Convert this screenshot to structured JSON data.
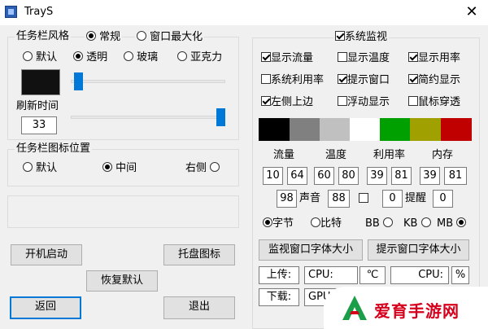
{
  "window": {
    "title": "TrayS",
    "close_glyph": "✕"
  },
  "taskbar_style": {
    "legend": "任务栏风格",
    "mode_options": [
      {
        "label": "常规",
        "selected": true
      },
      {
        "label": "窗口最大化",
        "selected": false
      }
    ],
    "style_options": [
      {
        "label": "默认",
        "selected": false
      },
      {
        "label": "透明",
        "selected": true
      },
      {
        "label": "玻璃",
        "selected": false
      },
      {
        "label": "亚克力",
        "selected": false
      }
    ],
    "color_preview": "#111111",
    "transparency_slider": 0.02,
    "refresh_label": "刷新时间",
    "refresh_value": "33",
    "refresh_slider": 1.0
  },
  "icon_position": {
    "legend": "任务栏图标位置",
    "options": [
      {
        "label": "默认",
        "selected": false
      },
      {
        "label": "中间",
        "selected": true
      },
      {
        "label": "右侧",
        "selected": false
      }
    ]
  },
  "buttons": {
    "autostart": "开机启动",
    "tray_icon": "托盘图标",
    "restore_default": "恢复默认",
    "back": "返回",
    "exit": "退出"
  },
  "monitor": {
    "legend": "系统监视",
    "enabled": true,
    "checks": [
      {
        "label": "显示流量",
        "checked": true
      },
      {
        "label": "显示温度",
        "checked": false
      },
      {
        "label": "显示用率",
        "checked": true
      },
      {
        "label": "系统利用率",
        "checked": false
      },
      {
        "label": "提示窗口",
        "checked": true
      },
      {
        "label": "简约显示",
        "checked": true
      },
      {
        "label": "左侧上边",
        "checked": true
      },
      {
        "label": "浮动显示",
        "checked": false
      },
      {
        "label": "鼠标穿透",
        "checked": false
      }
    ],
    "colors": [
      "#000000",
      "#808080",
      "#c0c0c0",
      "#ffffff",
      "#00a000",
      "#a0a000",
      "#c00000"
    ],
    "headers": {
      "traffic": "流量",
      "temperature": "温度",
      "usage": "利用率",
      "memory": "内存"
    },
    "thresholds": {
      "traffic": [
        "10",
        "64"
      ],
      "temperature": [
        "60",
        "80"
      ],
      "usage": [
        "39",
        "81"
      ],
      "memory": [
        "39",
        "81"
      ]
    },
    "sound_value": "98",
    "sound_label": "声音",
    "sound_field2": "88",
    "reminder_checkbox": false,
    "reminder_value1": "0",
    "reminder_label": "提醒",
    "reminder_value2": "0",
    "unit_options": [
      {
        "label": "字节",
        "selected": true
      },
      {
        "label": "比特",
        "selected": false
      },
      {
        "label": "BB",
        "selected": false
      },
      {
        "label": "KB",
        "selected": false
      },
      {
        "label": "MB",
        "selected": true
      }
    ],
    "monitor_font_button": "监视窗口字体大小",
    "tip_font_button": "提示窗口字体大小",
    "upload_label": "上传:",
    "download_label": "下载:",
    "cpu_label1": "CPU:",
    "celsius": "℃",
    "cpu_label2": "CPU:",
    "percent": "%",
    "gpu_label": "GPU"
  },
  "watermark": {
    "text": "爱育手游网",
    "logo_letter": "A",
    "color": "#d6001c"
  }
}
